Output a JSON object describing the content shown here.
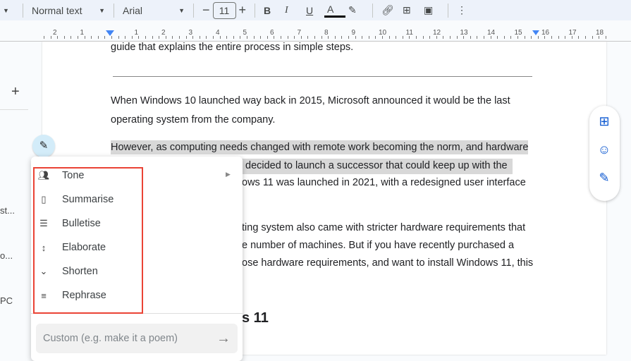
{
  "toolbar": {
    "style": "Normal text",
    "font": "Arial",
    "font_size": "11",
    "bold": "B",
    "italic": "I",
    "underline": "U",
    "text_color": "A"
  },
  "ruler": {
    "numbers": [
      "2",
      "1",
      "1",
      "2",
      "3",
      "4",
      "5",
      "6",
      "7",
      "8",
      "9",
      "10",
      "11",
      "12",
      "13",
      "14",
      "15",
      "16",
      "17",
      "18"
    ]
  },
  "sidebar": {
    "add": "+",
    "items": [
      "st...",
      "o...",
      "PC"
    ]
  },
  "document": {
    "lines": [
      "guide that explains the entire process in simple steps.",
      "When Windows 10 launched way back in 2015, Microsoft announced it would be the last",
      "operating system from the company.",
      "However, as computing needs changed with remote work becoming the norm, and hardware",
      "decided to launch a successor that could keep up with the",
      "ows 11 was launched in 2021, with a redesigned user interface",
      "ting system also came with stricter hardware requirements that",
      "e number of machines. But if you have recently purchased a",
      "ose hardware requirements, and want to install Windows 11, this"
    ],
    "heading": "s 11"
  },
  "menu": {
    "items": [
      {
        "label": "Tone",
        "icon": "tone-icon"
      },
      {
        "label": "Summarise",
        "icon": "summarise-icon"
      },
      {
        "label": "Bulletise",
        "icon": "bulletise-icon"
      },
      {
        "label": "Elaborate",
        "icon": "elaborate-icon"
      },
      {
        "label": "Shorten",
        "icon": "shorten-icon"
      },
      {
        "label": "Rephrase",
        "icon": "rephrase-icon"
      }
    ],
    "custom_placeholder": "Custom (e.g. make it a poem)"
  },
  "colors": {
    "accent": "#0b57d0",
    "highlight": "#d8d8d8",
    "redbox": "#ea4335"
  }
}
